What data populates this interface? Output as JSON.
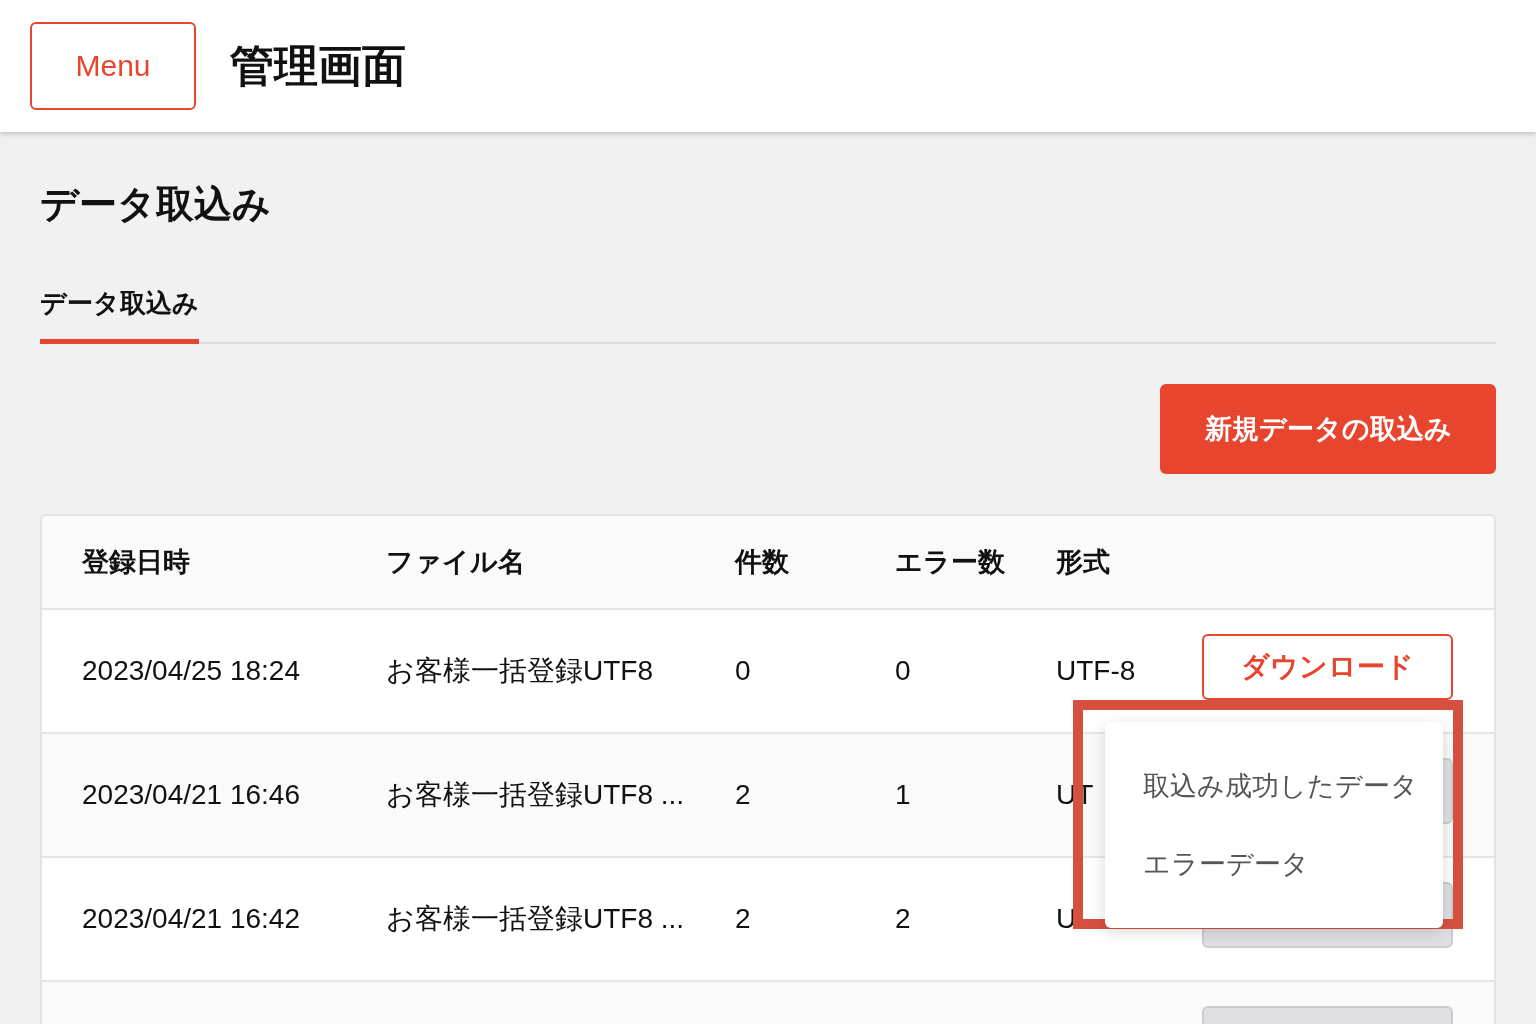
{
  "header": {
    "menu_button": "Menu",
    "title": "管理画面"
  },
  "page_title": "データ取込み",
  "tabs": [
    {
      "label": "データ取込み",
      "selected": true
    }
  ],
  "new_import_button": "新規データの取込み",
  "table": {
    "columns": [
      "登録日時",
      "ファイル名",
      "件数",
      "エラー数",
      "形式"
    ],
    "rows": [
      {
        "date": "2023/04/25 18:24",
        "file": "お客様一括登録UTF8",
        "count": "0",
        "errors": "0",
        "format": "UTF-8",
        "button": {
          "label": "ダウンロード",
          "disabled": false
        }
      },
      {
        "date": "2023/04/21 16:46",
        "file": "お客様一括登録UTF8 ...",
        "count": "2",
        "errors": "1",
        "format": "UT",
        "button": {
          "disabled": true
        }
      },
      {
        "date": "2023/04/21 16:42",
        "file": "お客様一括登録UTF8 ...",
        "count": "2",
        "errors": "2",
        "format": "U",
        "button": {
          "disabled": true
        }
      },
      {
        "button": {
          "disabled": true
        }
      }
    ]
  },
  "dropdown": {
    "items": [
      "取込み成功したデータ",
      "エラーデータ"
    ],
    "highlighted": true
  }
}
